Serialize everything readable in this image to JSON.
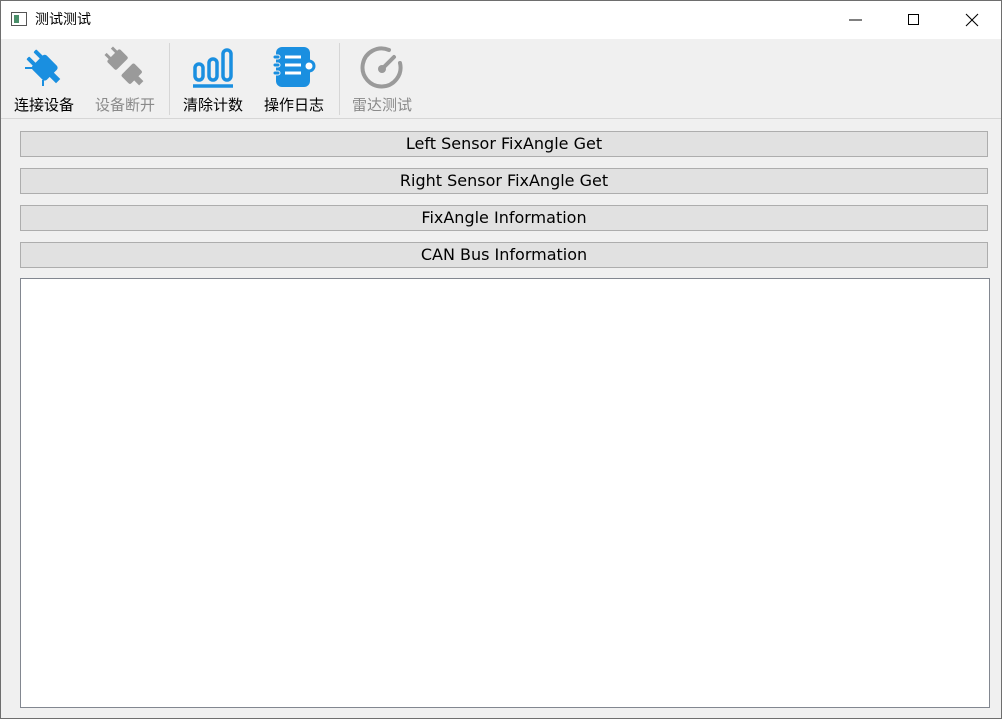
{
  "window": {
    "title": "测试测试"
  },
  "toolbar": {
    "items": [
      {
        "label": "连接设备",
        "icon": "plug-connect-icon",
        "enabled": true
      },
      {
        "label": "设备断开",
        "icon": "plug-disconnect-icon",
        "enabled": false
      },
      {
        "label": "清除计数",
        "icon": "bar-counter-icon",
        "enabled": true
      },
      {
        "label": "操作日志",
        "icon": "log-notebook-icon",
        "enabled": true
      },
      {
        "label": "雷达测试",
        "icon": "radar-gauge-icon",
        "enabled": false
      }
    ]
  },
  "actions": {
    "left_sensor": "Left Sensor FixAngle Get",
    "right_sensor": "Right Sensor FixAngle Get",
    "fixangle_info": "FixAngle Information",
    "can_bus_info": "CAN Bus Information"
  },
  "output": {
    "text": ""
  },
  "colors": {
    "accent": "#1a8fe0",
    "disabled": "#9a9a9a"
  }
}
